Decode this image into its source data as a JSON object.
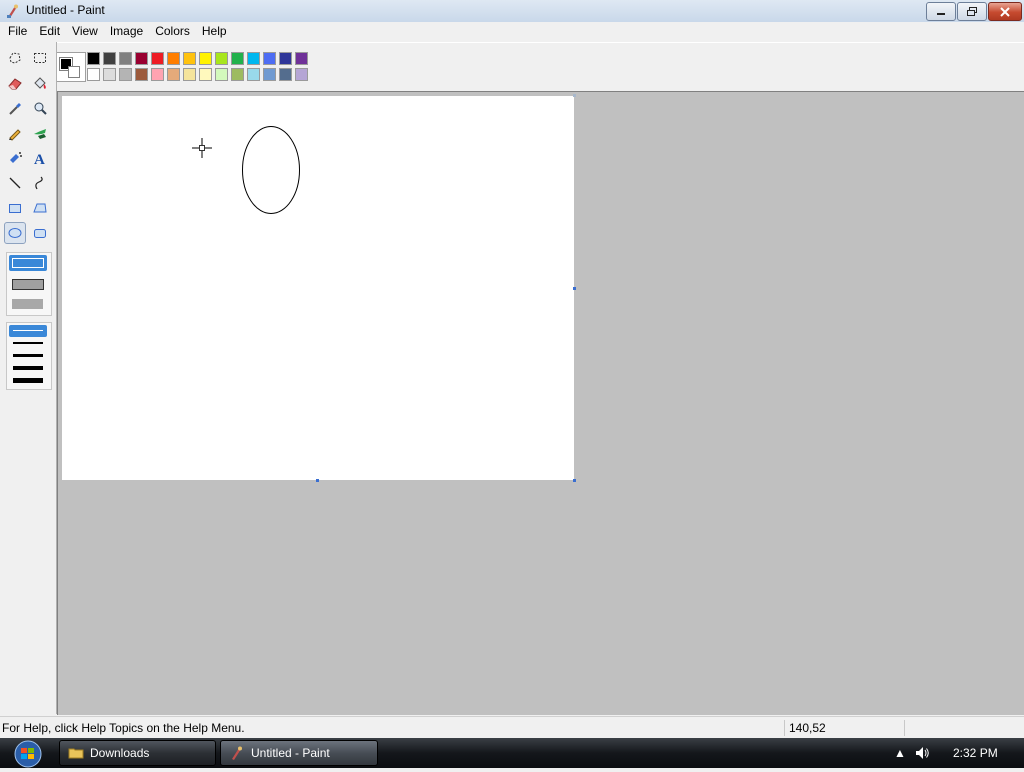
{
  "window": {
    "title": "Untitled - Paint"
  },
  "menu": [
    "File",
    "Edit",
    "View",
    "Image",
    "Colors",
    "Help"
  ],
  "palette": {
    "foreground": "#000000",
    "background": "#ffffff",
    "row1": [
      "#000000",
      "#404040",
      "#808080",
      "#990030",
      "#ed1c24",
      "#ff7e00",
      "#ffc20e",
      "#fff200",
      "#a8e61d",
      "#22b14c",
      "#00b7ef",
      "#4d6df3",
      "#2f3699",
      "#6f3198"
    ],
    "row2": [
      "#ffffff",
      "#dcdcdc",
      "#b4b4b4",
      "#9c5a3c",
      "#ffa3b1",
      "#e5aa7a",
      "#f5e49c",
      "#fff9bd",
      "#d3f9bc",
      "#9dbb61",
      "#99d9ea",
      "#709ad1",
      "#546d8e",
      "#b5a5d5"
    ]
  },
  "tools": [
    {
      "name": "free-select",
      "icon": "free-select-icon"
    },
    {
      "name": "rect-select",
      "icon": "rect-select-icon"
    },
    {
      "name": "eraser",
      "icon": "eraser-icon"
    },
    {
      "name": "fill",
      "icon": "fill-bucket-icon"
    },
    {
      "name": "pick-color",
      "icon": "eyedropper-icon"
    },
    {
      "name": "magnifier",
      "icon": "magnifier-icon"
    },
    {
      "name": "pencil",
      "icon": "pencil-icon"
    },
    {
      "name": "brush",
      "icon": "brush-icon"
    },
    {
      "name": "airbrush",
      "icon": "airbrush-icon"
    },
    {
      "name": "text",
      "icon": "text-icon"
    },
    {
      "name": "line",
      "icon": "line-icon"
    },
    {
      "name": "curve",
      "icon": "curve-icon"
    },
    {
      "name": "rectangle",
      "icon": "rectangle-icon"
    },
    {
      "name": "polygon",
      "icon": "polygon-icon"
    },
    {
      "name": "ellipse",
      "icon": "ellipse-icon",
      "active": true
    },
    {
      "name": "rounded-rectangle",
      "icon": "rounded-rectangle-icon"
    }
  ],
  "status": {
    "help_text": "For Help, click Help Topics on the Help Menu.",
    "coordinates": "140,52"
  },
  "taskbar": {
    "buttons": [
      {
        "label": "Downloads",
        "icon": "folder-icon"
      },
      {
        "label": "Untitled - Paint",
        "icon": "paint-icon",
        "active": true
      }
    ],
    "time": "2:32 PM"
  }
}
